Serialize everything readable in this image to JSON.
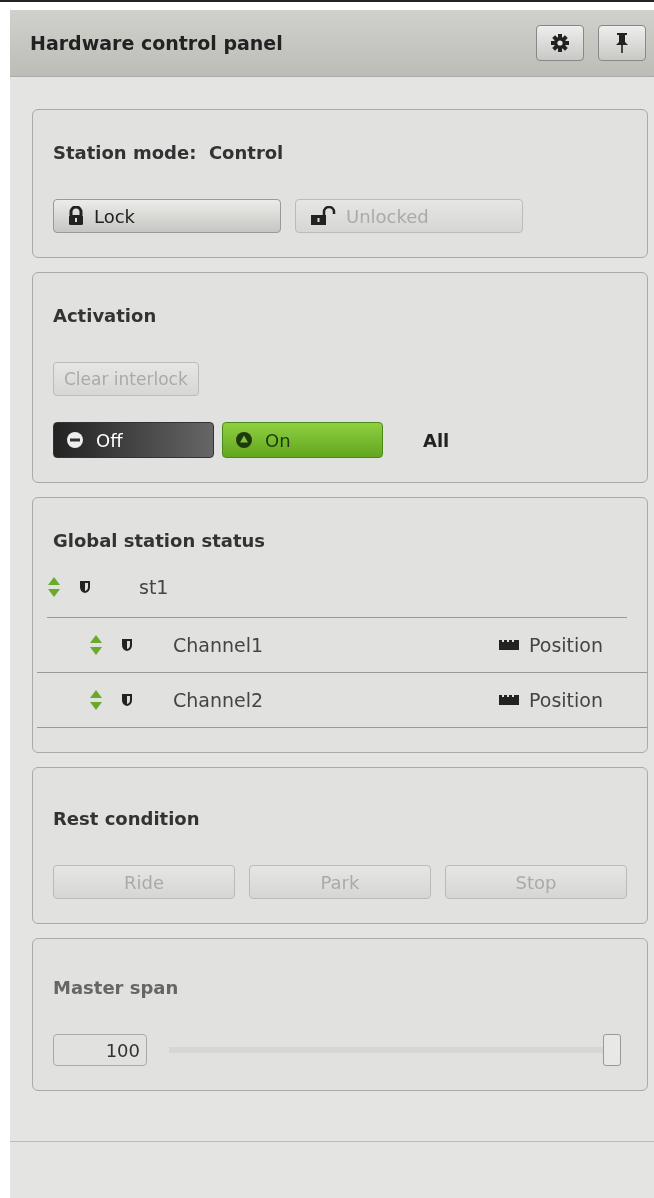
{
  "header": {
    "title": "Hardware control panel",
    "buttons": [
      {
        "kind": "settings"
      },
      {
        "kind": "pin"
      }
    ]
  },
  "station_mode": {
    "label": "Station mode:",
    "value": "Control",
    "buttons": [
      {
        "label": "Lock",
        "kind": "lock",
        "disabled": false
      },
      {
        "label": "Unlocked",
        "kind": "unlock",
        "disabled": true
      }
    ]
  },
  "activation": {
    "title": "Activation",
    "clear_interlock": {
      "label": "Clear interlock",
      "disabled": true
    },
    "switch": [
      {
        "label": "Off",
        "kind": "off",
        "selected": false
      },
      {
        "label": "On",
        "kind": "on",
        "selected": true
      }
    ],
    "scope": "All"
  },
  "status": {
    "title": "Global station status",
    "station": {
      "name": "st1",
      "children": [
        {
          "name": "Channel1",
          "mode": "Position"
        },
        {
          "name": "Channel2",
          "mode": "Position"
        }
      ]
    }
  },
  "rest_condition": {
    "title": "Rest condition",
    "buttons": [
      {
        "label": "Ride",
        "disabled": true
      },
      {
        "label": "Park",
        "disabled": true
      },
      {
        "label": "Stop",
        "disabled": true
      }
    ]
  },
  "master_span": {
    "title": "Master span",
    "value": "100",
    "level": 1.0
  }
}
